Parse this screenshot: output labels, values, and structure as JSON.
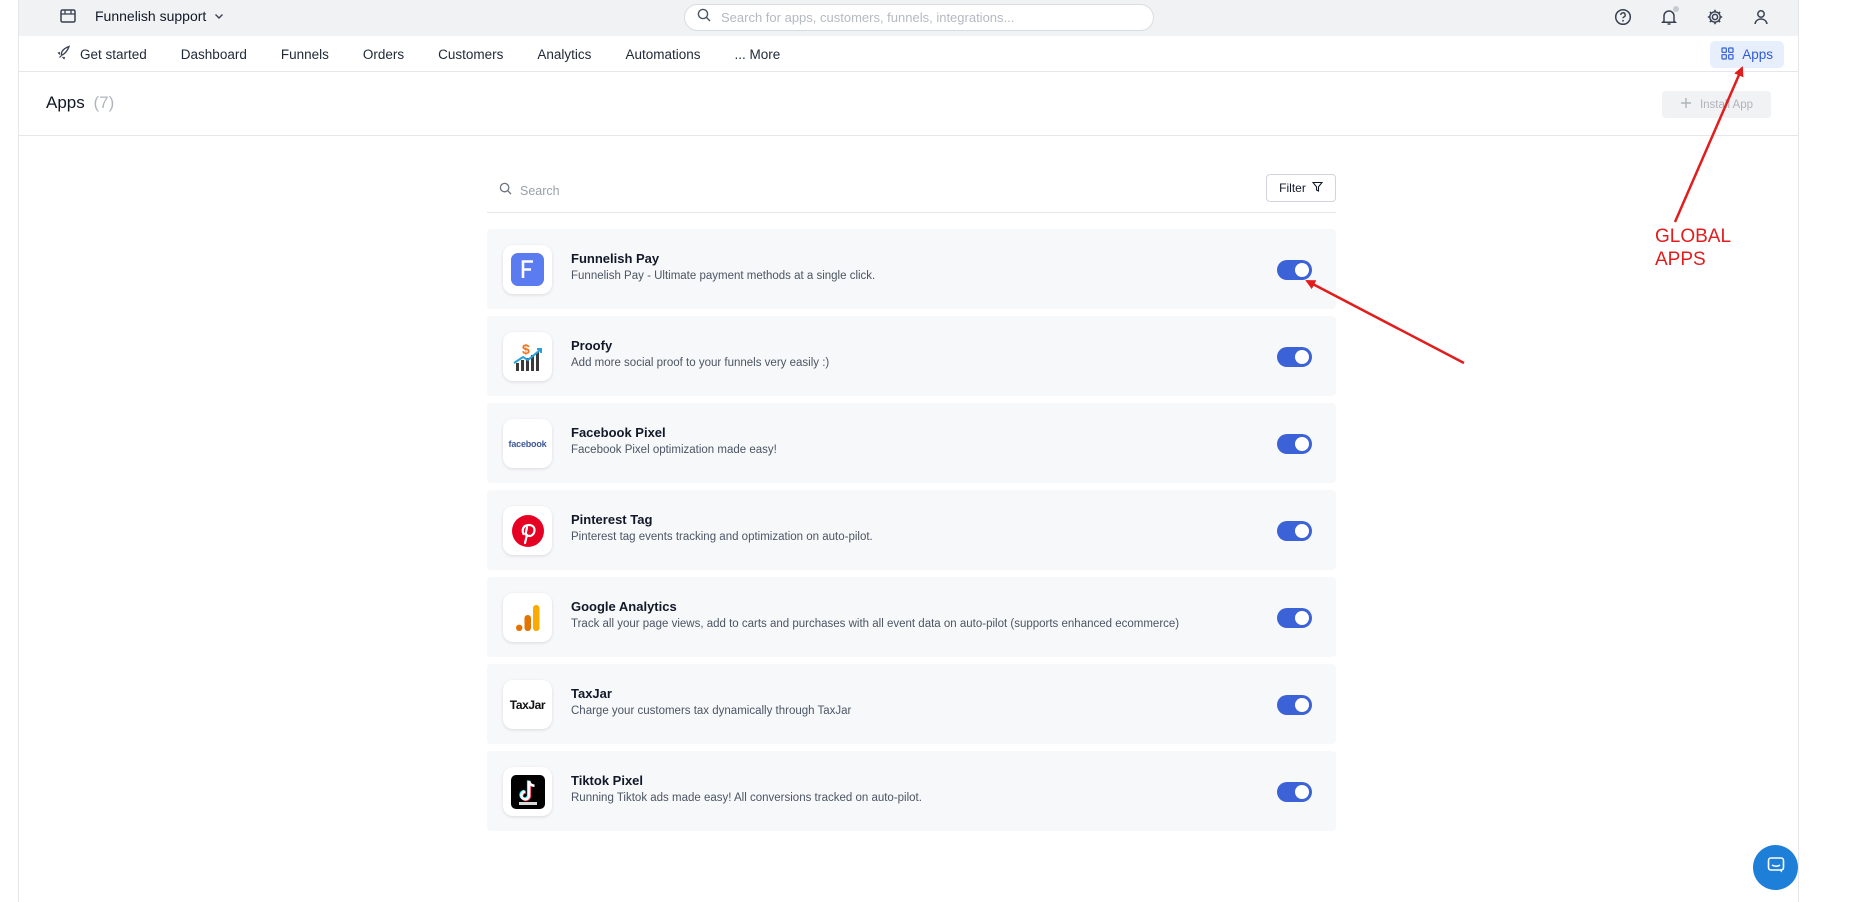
{
  "topbar": {
    "store_name": "Funnelish support",
    "search_placeholder": "Search for apps, customers, funnels, integrations..."
  },
  "nav": {
    "items": [
      {
        "label": "Get started",
        "icon": "rocket-icon"
      },
      {
        "label": "Dashboard"
      },
      {
        "label": "Funnels"
      },
      {
        "label": "Orders"
      },
      {
        "label": "Customers"
      },
      {
        "label": "Analytics"
      },
      {
        "label": "Automations"
      },
      {
        "label": "... More"
      }
    ],
    "apps_tab": "Apps"
  },
  "header": {
    "title": "Apps",
    "count": "(7)",
    "install_button": "Install App"
  },
  "list": {
    "search_placeholder": "Search",
    "filter_label": "Filter",
    "apps": [
      {
        "name": "Funnelish Pay",
        "description": "Funnelish Pay - Ultimate payment methods at a single click.",
        "enabled": true,
        "logo": "funnelish-pay-logo"
      },
      {
        "name": "Proofy",
        "description": "Add more social proof to your funnels very easily :)",
        "enabled": true,
        "logo": "proofy-logo"
      },
      {
        "name": "Facebook Pixel",
        "description": "Facebook Pixel optimization made easy!",
        "enabled": true,
        "logo": "facebook-logo",
        "logo_text": "facebook"
      },
      {
        "name": "Pinterest Tag",
        "description": "Pinterest tag events tracking and optimization on auto-pilot.",
        "enabled": true,
        "logo": "pinterest-logo"
      },
      {
        "name": "Google Analytics",
        "description": "Track all your page views, add to carts and purchases with all event data on auto-pilot (supports enhanced ecommerce)",
        "enabled": true,
        "logo": "google-analytics-logo"
      },
      {
        "name": "TaxJar",
        "description": "Charge your customers tax dynamically through TaxJar",
        "enabled": true,
        "logo": "taxjar-logo",
        "logo_text": "TaxJar"
      },
      {
        "name": "Tiktok Pixel",
        "description": "Running Tiktok ads made easy! All conversions tracked on auto-pilot.",
        "enabled": true,
        "logo": "tiktok-logo"
      }
    ]
  },
  "annotation": {
    "line1": "GLOBAL",
    "line2": "APPS",
    "color": "#e11d1d"
  },
  "colors": {
    "accent": "#3b62d6",
    "apps_tab_bg": "#e8effc",
    "chat": "#1e7fd8"
  }
}
